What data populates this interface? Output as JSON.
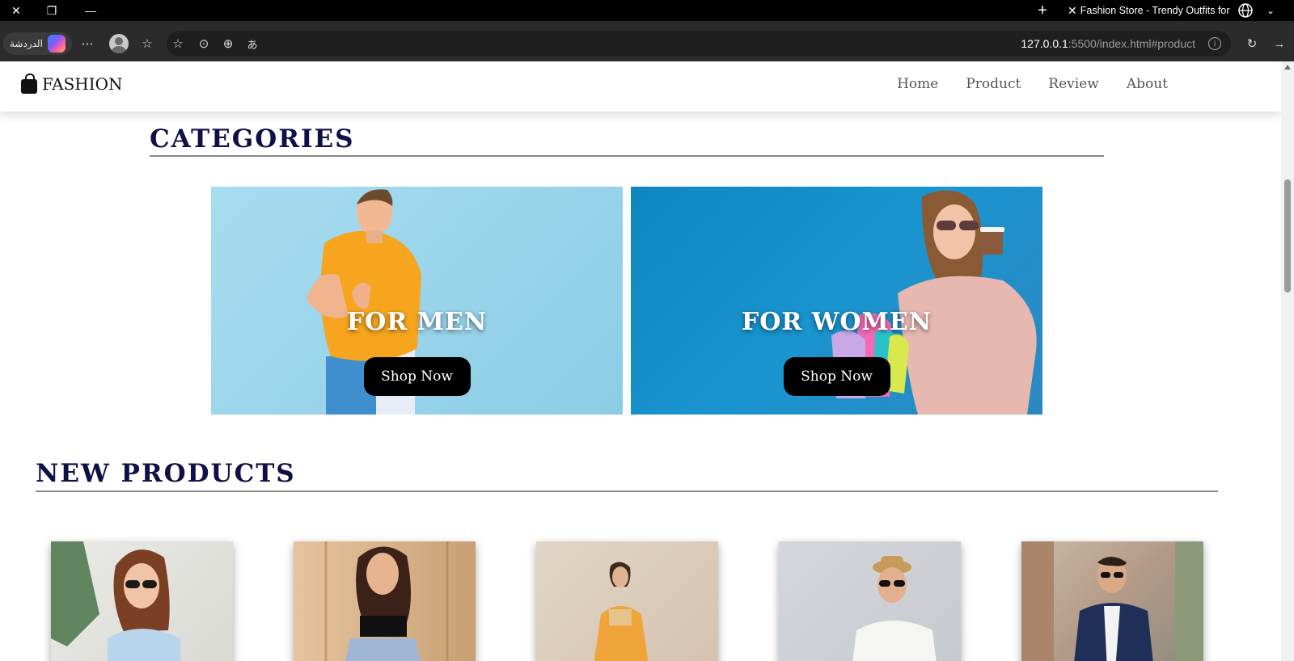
{
  "browser": {
    "tab_title": "Fashion Store - Trendy Outfits for",
    "copilot_label": "الدردشة",
    "url_host": "127.0.0.1",
    "url_rest": ":5500/index.html#product"
  },
  "header": {
    "logo": "FASHION",
    "nav": [
      "Home",
      "Product",
      "Review",
      "About"
    ]
  },
  "categories": {
    "title": "CATEGORIES",
    "items": [
      {
        "label": "FOR MEN",
        "button": "Shop Now"
      },
      {
        "label": "FOR WOMEN",
        "button": "Shop Now"
      }
    ]
  },
  "new_products": {
    "title": "NEW PRODUCTS"
  }
}
